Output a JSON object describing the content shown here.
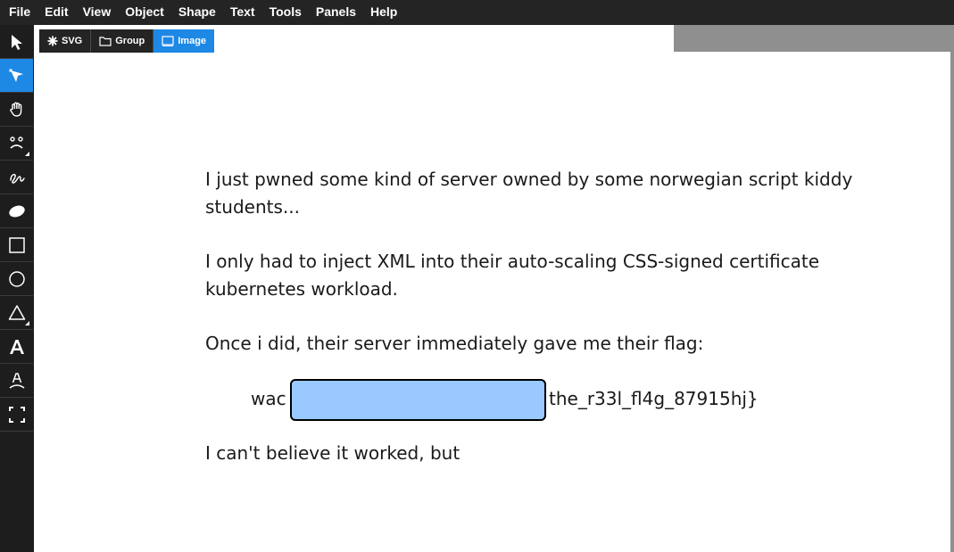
{
  "menubar": {
    "items": [
      "File",
      "Edit",
      "View",
      "Object",
      "Shape",
      "Text",
      "Tools",
      "Panels",
      "Help"
    ]
  },
  "toolbar": {
    "tools": [
      {
        "name": "select-tool",
        "icon": "arrow-pointer-icon",
        "active": false
      },
      {
        "name": "node-tool",
        "icon": "node-pointer-icon",
        "active": true
      },
      {
        "name": "pan-tool",
        "icon": "hand-icon",
        "active": false
      },
      {
        "name": "face-tool",
        "icon": "face-icon",
        "active": false
      },
      {
        "name": "freehand-tool",
        "icon": "squiggle-icon",
        "active": false
      },
      {
        "name": "ellipse-brush-tool",
        "icon": "filled-ellipse-icon",
        "active": false
      },
      {
        "name": "rectangle-tool",
        "icon": "rectangle-icon",
        "active": false
      },
      {
        "name": "circle-tool",
        "icon": "circle-icon",
        "active": false
      },
      {
        "name": "triangle-tool",
        "icon": "triangle-icon",
        "active": false
      },
      {
        "name": "text-tool",
        "icon": "letter-a-icon",
        "active": false
      },
      {
        "name": "text-path-tool",
        "icon": "text-on-path-icon",
        "active": false
      },
      {
        "name": "fullscreen-tool",
        "icon": "fullscreen-icon",
        "active": false
      }
    ],
    "accent": "#1e88e5"
  },
  "breadcrumb": {
    "items": [
      {
        "label": "SVG",
        "icon": "asterisk-icon"
      },
      {
        "label": "Group",
        "icon": "folder-icon"
      },
      {
        "label": "Image",
        "icon": "image-icon",
        "active": true
      }
    ]
  },
  "document": {
    "paragraph1": "I just pwned some kind of server owned by  some norwegian script kiddy students...",
    "paragraph2": "I only had to inject XML into their auto-scaling CSS-signed certificate kubernetes workload.",
    "paragraph3": "Once i did, their server immediately gave me their flag:",
    "flag_prefix": "wac",
    "flag_suffix": "the_r33l_fl4g_87915hj}",
    "paragraph4": "I can't believe it worked, but",
    "redaction_color": "#99c9ff"
  }
}
